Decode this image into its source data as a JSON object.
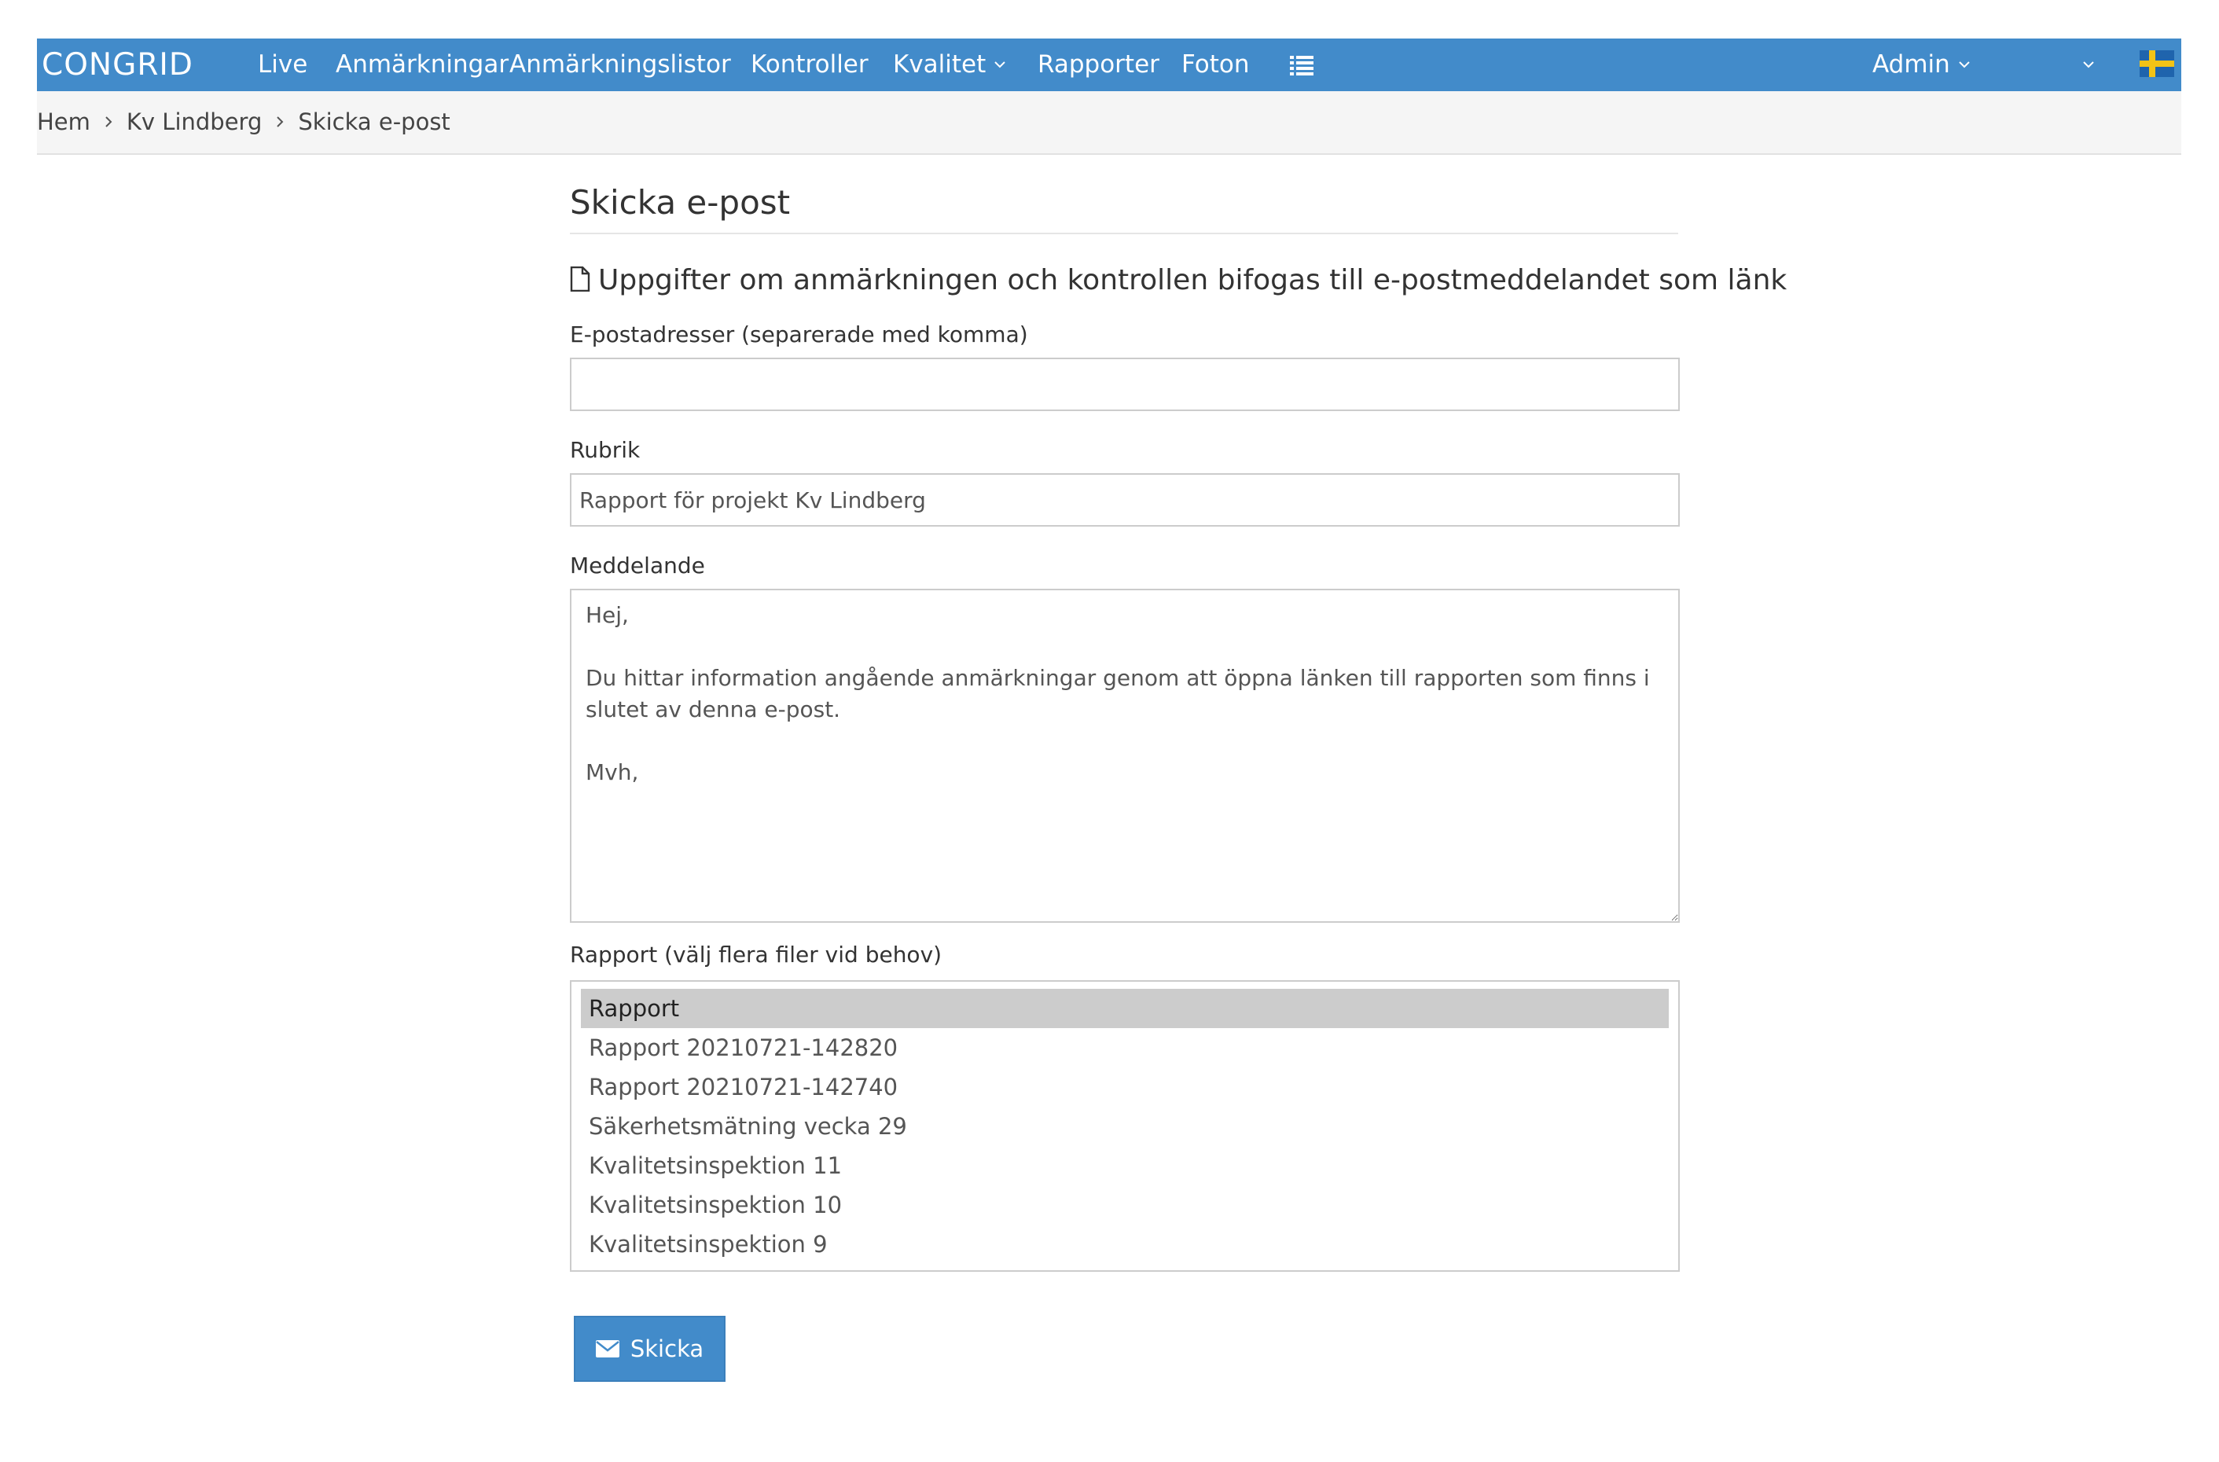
{
  "app": {
    "logo_text": "CONGRID"
  },
  "nav": {
    "items": [
      {
        "label": "Live"
      },
      {
        "label": "Anmärkningar"
      },
      {
        "label": "Anmärkningslistor"
      },
      {
        "label": "Kontroller"
      },
      {
        "label": "Kvalitet"
      },
      {
        "label": "Rapporter"
      },
      {
        "label": "Foton"
      }
    ],
    "list_icon": "list-icon",
    "user_menu_label": "Admin",
    "project_dropdown_icon": "chevron-down-icon",
    "language_flag": "swedish-flag-icon"
  },
  "breadcrumb": {
    "items": [
      "Hem",
      "Kv Lindberg",
      "Skicka e-post"
    ]
  },
  "page": {
    "title": "Skicka e-post",
    "info_icon": "file-icon",
    "info_text": "Uppgifter om anmärkningen och kontrollen bifogas till e-postmeddelandet som länk"
  },
  "form": {
    "emails": {
      "label": "E-postadresser (separerade med komma)",
      "value": ""
    },
    "subject": {
      "label": "Rubrik",
      "value": "Rapport för projekt Kv Lindberg"
    },
    "message": {
      "label": "Meddelande",
      "value": "Hej,\n\nDu hittar information angående anmärkningar genom att öppna länken till rapporten som finns i slutet av denna e-post.\n\nMvh,"
    },
    "reports": {
      "label": "Rapport (välj flera filer vid behov)",
      "options": [
        {
          "label": "Rapport",
          "selected": true
        },
        {
          "label": "Rapport 20210721-142820",
          "selected": false
        },
        {
          "label": "Rapport 20210721-142740",
          "selected": false
        },
        {
          "label": "Säkerhetsmätning vecka 29",
          "selected": false
        },
        {
          "label": "Kvalitetsinspektion 11",
          "selected": false
        },
        {
          "label": "Kvalitetsinspektion 10",
          "selected": false
        },
        {
          "label": "Kvalitetsinspektion 9",
          "selected": false
        }
      ]
    },
    "submit_label": "Skicka",
    "submit_icon": "envelope-icon"
  },
  "colors": {
    "brand": "#428bca",
    "selected_option": "#cccccc"
  }
}
